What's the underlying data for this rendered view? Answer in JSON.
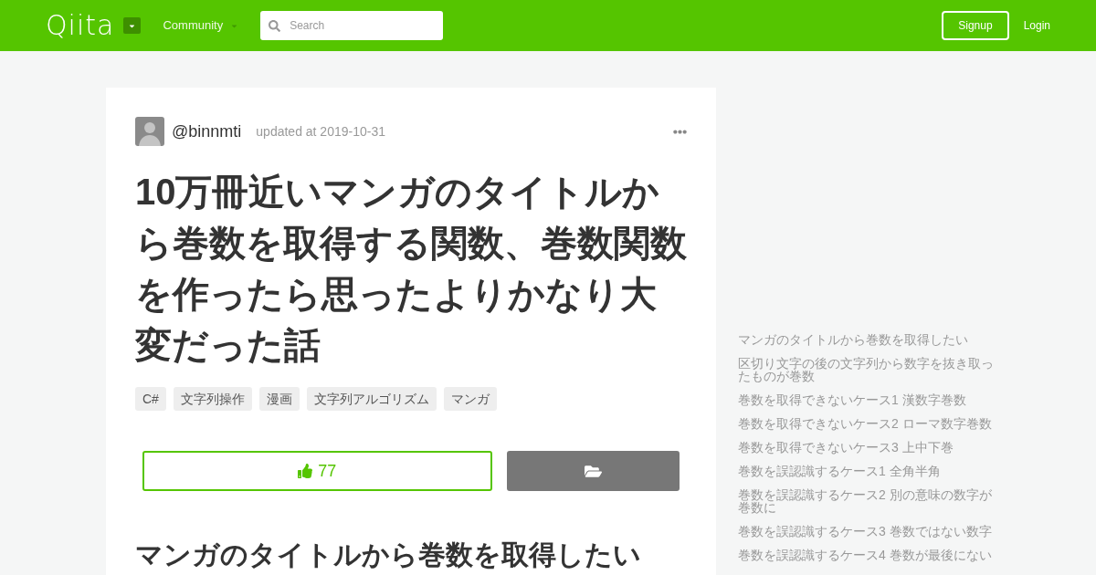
{
  "header": {
    "logo": "Qiita",
    "menu": {
      "label": "Community"
    },
    "search": {
      "placeholder": "Search"
    },
    "buttons": [
      {
        "label": "Signup",
        "kind": "outlined"
      },
      {
        "label": "Login",
        "kind": "plain"
      }
    ]
  },
  "article": {
    "author": "@binnmti",
    "updated": "updated at 2019-10-31",
    "title": "10万冊近いマンガのタイトルから巻数を取得する関数、巻数関数を作ったら思ったよりかなり大変だった話",
    "tags": [
      "C#",
      "文字列操作",
      "漫画",
      "文字列アルゴリズム",
      "マンガ"
    ],
    "likes": "77",
    "section_heading": "マンガのタイトルから巻数を取得したい"
  },
  "toc": {
    "items": [
      "マンガのタイトルから巻数を取得したい",
      "区切り文字の後の文字列から数字を抜き取ったものが巻数",
      "巻数を取得できないケース1 漢数字巻数",
      "巻数を取得できないケース2 ローマ数字巻数",
      "巻数を取得できないケース3 上中下巻",
      "巻数を誤認識するケース1 全角半角",
      "巻数を誤認識するケース2 別の意味の数字が巻数に",
      "巻数を誤認識するケース3 巻数ではない数字",
      "巻数を誤認識するケース4 巻数が最後にない"
    ]
  }
}
